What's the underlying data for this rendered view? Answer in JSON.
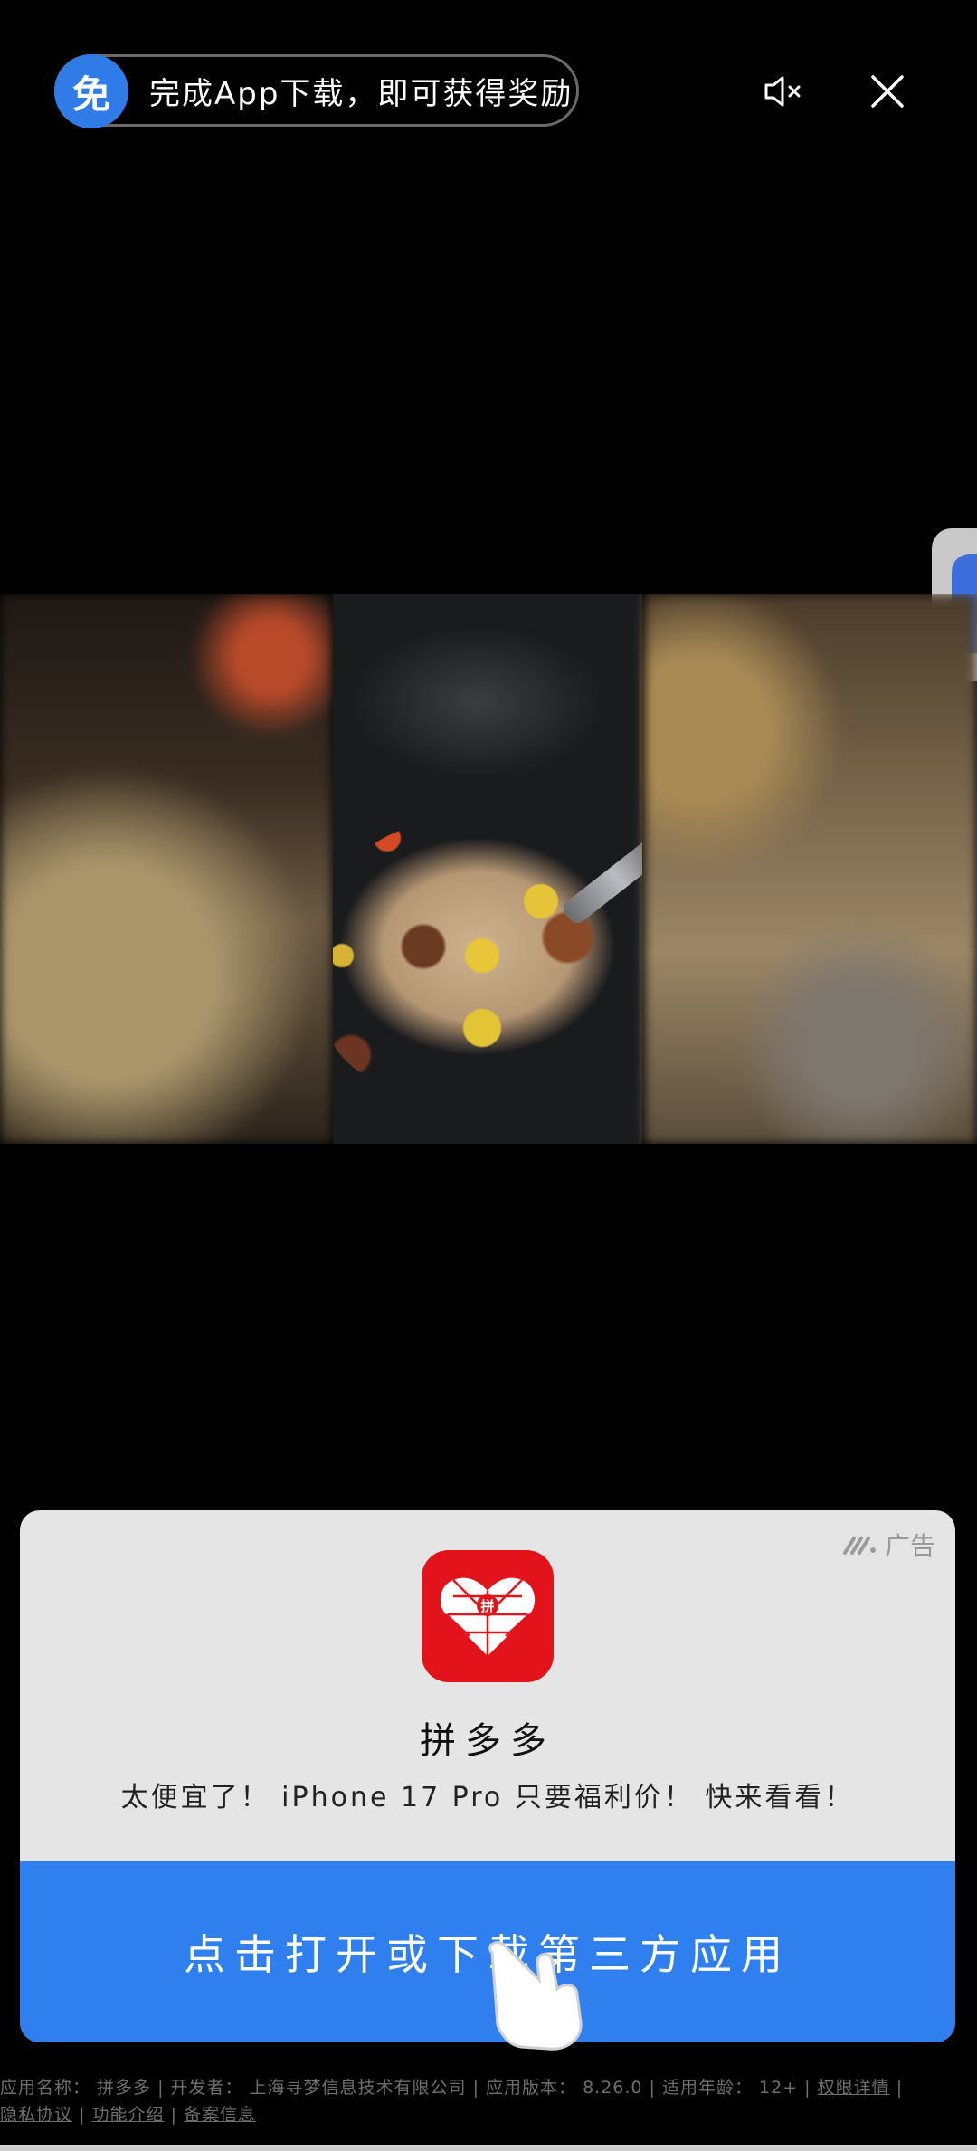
{
  "reward": {
    "badge": "免",
    "text": "完成App下载，即可获得奖励"
  },
  "controls": {
    "mute_icon": "speaker-muted-icon",
    "close_icon": "close-icon"
  },
  "ad": {
    "label": "广告",
    "app_name": "拼多多",
    "app_icon_text": "拼",
    "description": "太便宜了！ iPhone 17 Pro 只要福利价！ 快来看看！",
    "cta": "点击打开或下载第三方应用"
  },
  "footer": {
    "info_line": "应用名称： 拼多多 | 开发者： 上海寻梦信息技术有限公司 | 应用版本： 8.26.0 | 适用年龄： 12+ |",
    "links_row1": [
      "权限详情"
    ],
    "links_row2": [
      "隐私协议",
      "功能介绍",
      "备案信息"
    ],
    "separator": "|"
  },
  "colors": {
    "accent": "#2f80ee",
    "brand_red": "#e3131b",
    "badge_blue": "#2f7be8"
  }
}
